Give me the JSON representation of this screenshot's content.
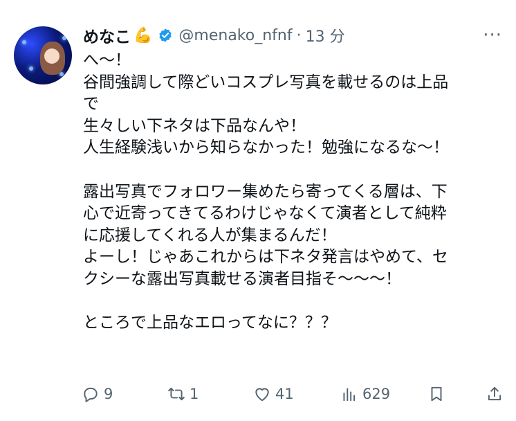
{
  "user": {
    "display_name": "めなこ",
    "name_emoji": "💪",
    "handle": "@menako_nfnf",
    "time": "13 分"
  },
  "tweet": {
    "lines": [
      "へ〜！",
      "谷間強調して際どいコスプレ写真を載せるのは上品",
      "で",
      "生々しい下ネタは下品なんや！",
      "人生経験浅いから知らなかった！勉強になるな〜！",
      "",
      "露出写真でフォロワー集めたら寄ってくる層は、下",
      "心で近寄ってきてるわけじゃなくて演者として純粋",
      "に応援してくれる人が集まるんだ！",
      "よーし！じゃあこれからは下ネタ発言はやめて、セ",
      "クシーな露出写真載せる演者目指そ〜〜〜！",
      "",
      "ところで上品なエロってなに？？？"
    ]
  },
  "actions": {
    "replies": "9",
    "retweets": "1",
    "likes": "41",
    "views": "629"
  },
  "colors": {
    "verified": "#1d9bf0",
    "muted": "#536471"
  },
  "icons": [
    "more-icon",
    "reply-icon",
    "retweet-icon",
    "like-icon",
    "views-icon",
    "bookmark-icon",
    "share-icon",
    "verified-badge-icon"
  ]
}
